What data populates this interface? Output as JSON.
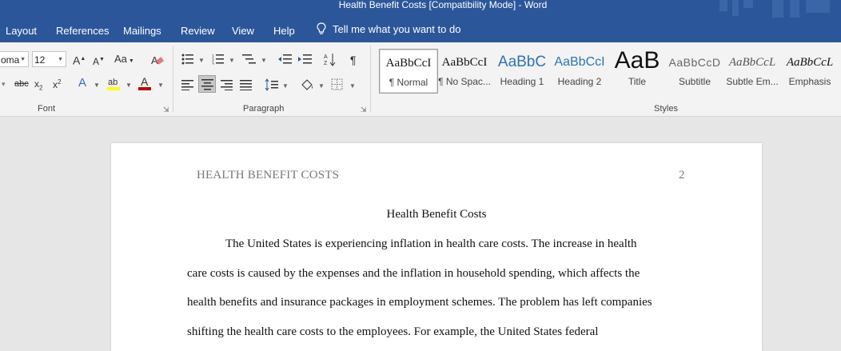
{
  "window": {
    "title": "Health Benefit Costs [Compatibility Mode]  -  Word"
  },
  "menu": {
    "tabs": [
      "Layout",
      "References",
      "Mailings",
      "Review",
      "View",
      "Help"
    ],
    "tell_me": "Tell me what you want to do"
  },
  "ribbon": {
    "font": {
      "name": "oma",
      "size": "12",
      "group_label": "Font"
    },
    "paragraph": {
      "group_label": "Paragraph"
    },
    "styles": {
      "group_label": "Styles",
      "items": [
        {
          "preview": "AaBbCcI",
          "name": "¶ Normal"
        },
        {
          "preview": "AaBbCcI",
          "name": "¶ No Spac..."
        },
        {
          "preview": "AaBbC",
          "name": "Heading 1"
        },
        {
          "preview": "AaBbCcI",
          "name": "Heading 2"
        },
        {
          "preview": "AaB",
          "name": "Title"
        },
        {
          "preview": "AaBbCcD",
          "name": "Subtitle"
        },
        {
          "preview": "AaBbCcL",
          "name": "Subtle Em..."
        },
        {
          "preview": "AaBbCcL",
          "name": "Emphasis"
        }
      ]
    }
  },
  "document": {
    "running_head": "HEALTH BENEFIT COSTS",
    "page_number": "2",
    "title": "Health Benefit Costs",
    "lines": [
      "The United States is experiencing inflation in health care costs. The increase in health",
      "care costs is caused by the expenses and the inflation in household spending, which affects the",
      "health benefits and insurance packages in employment schemes. The problem has left companies",
      "shifting the health care costs to the employees. For example, the United States federal"
    ]
  },
  "colors": {
    "brand_blue": "#2b579a",
    "font_color_red": "#c00000",
    "highlight_yellow": "#ffff00"
  }
}
